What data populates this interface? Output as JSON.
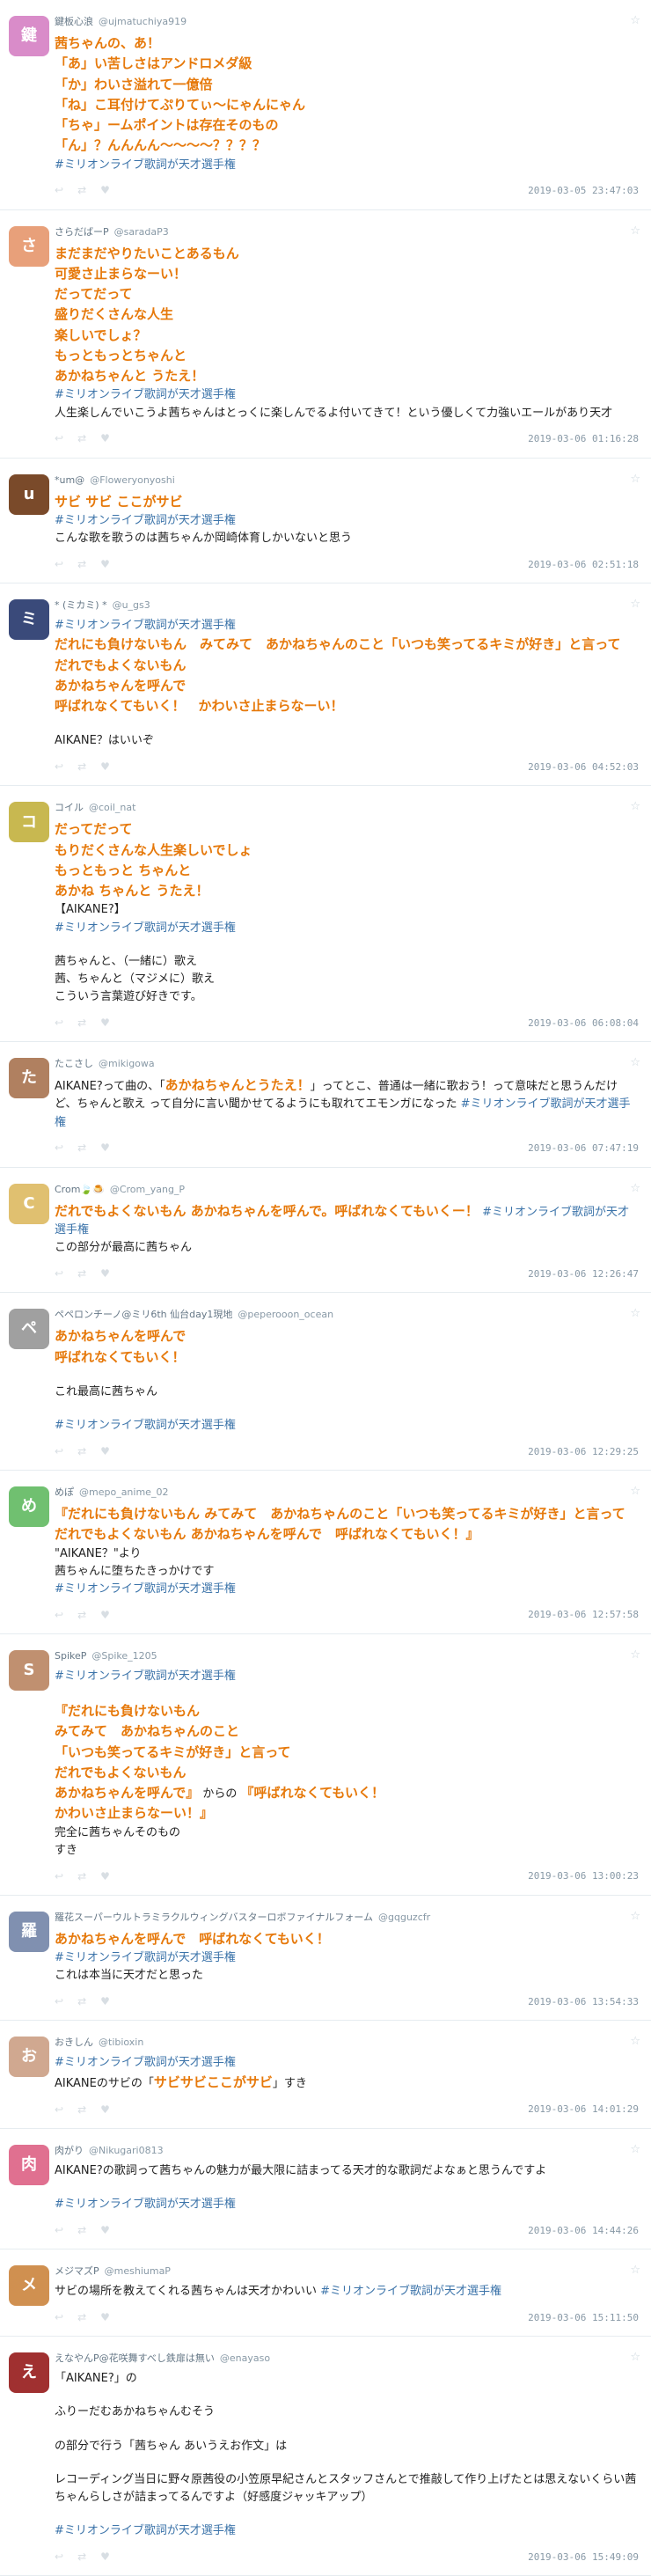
{
  "hashtag": "#ミリオンライブ歌詞が天才選手権",
  "tweets": [
    {
      "name": "鍵板心浪",
      "handle": "@ujmatuchiya919",
      "date": "2019-03-05 23:47:03",
      "avatar_color": "#d98cc9",
      "avatar_glyph": "鍵",
      "lines": [
        {
          "t": "em",
          "text": "茜ちゃんの、あ！"
        },
        {
          "t": "em",
          "text": "「あ」い苦しさはアンドロメダ級"
        },
        {
          "t": "em",
          "text": "「か」わいさ溢れて一億倍"
        },
        {
          "t": "em",
          "text": "「ね」こ耳付けてぷりてぃ〜にゃんにゃん"
        },
        {
          "t": "em",
          "text": "「ちゃ」ームポイントは存在そのもの"
        },
        {
          "t": "em",
          "text": "「ん」？んんんん〜〜〜〜？？？？"
        },
        {
          "t": "tag",
          "text": "#ミリオンライブ歌詞が天才選手権"
        }
      ]
    },
    {
      "name": "さらだばーP",
      "handle": "@saradaP3",
      "date": "2019-03-06 01:16:28",
      "avatar_color": "#e8a07a",
      "avatar_glyph": "さ",
      "lines": [
        {
          "t": "em",
          "text": "まだまだやりたいことあるもん"
        },
        {
          "t": "em",
          "text": "可愛さ止まらなーい！"
        },
        {
          "t": "em",
          "text": "だってだって"
        },
        {
          "t": "em",
          "text": "盛りだくさんな人生"
        },
        {
          "t": "em",
          "text": "楽しいでしょ？"
        },
        {
          "t": "em",
          "text": "もっともっとちゃんと"
        },
        {
          "t": "em",
          "text": "あかねちゃんと うたえ！"
        },
        {
          "t": "tag",
          "text": "#ミリオンライブ歌詞が天才選手権"
        },
        {
          "t": "plain",
          "text": "人生楽しんでいこうよ茜ちゃんはとっくに楽しんでるよ付いてきて！という優しくて力強いエールがあり天才"
        }
      ]
    },
    {
      "name": "*um@",
      "handle": "@Floweryonyoshi",
      "date": "2019-03-06 02:51:18",
      "avatar_color": "#7a4a2a",
      "avatar_glyph": "u",
      "lines": [
        {
          "t": "em",
          "text": "サビ サビ ここがサビ"
        },
        {
          "t": "tag",
          "text": "#ミリオンライブ歌詞が天才選手権"
        },
        {
          "t": "plain",
          "text": "こんな歌を歌うのは茜ちゃんか岡崎体育しかいないと思う"
        }
      ]
    },
    {
      "name": "* (ミカミ) *",
      "handle": "@u_gs3",
      "date": "2019-03-06 04:52:03",
      "avatar_color": "#3a4a7a",
      "avatar_glyph": "ミ",
      "lines": [
        {
          "t": "tag",
          "text": "#ミリオンライブ歌詞が天才選手権"
        },
        {
          "t": "em",
          "text": "だれにも負けないもん　みてみて　あかねちゃんのこと「いつも笑ってるキミが好き」と言って"
        },
        {
          "t": "em",
          "text": "だれでもよくないもん"
        },
        {
          "t": "em",
          "text": "あかねちゃんを呼んで"
        },
        {
          "t": "em",
          "text": "呼ばれなくてもいく！　かわいさ止まらなーい！"
        },
        {
          "t": "blank",
          "text": ""
        },
        {
          "t": "plain",
          "text": "AIKANE？はいいぞ"
        }
      ]
    },
    {
      "name": "コイル",
      "handle": "@coil_nat",
      "date": "2019-03-06 06:08:04",
      "avatar_color": "#c8b850",
      "avatar_glyph": "コ",
      "lines": [
        {
          "t": "em",
          "text": "だってだって"
        },
        {
          "t": "em",
          "text": "もりだくさんな人生楽しいでしょ"
        },
        {
          "t": "em",
          "text": "もっともっと ちゃんと"
        },
        {
          "t": "em",
          "text": "あかね ちゃんと うたえ！"
        },
        {
          "t": "plain",
          "text": "【AIKANE?】"
        },
        {
          "t": "tag",
          "text": "#ミリオンライブ歌詞が天才選手権"
        },
        {
          "t": "blank",
          "text": ""
        },
        {
          "t": "plain",
          "text": "茜ちゃんと、（一緒に）歌え"
        },
        {
          "t": "plain",
          "text": "茜、ちゃんと（マジメに）歌え"
        },
        {
          "t": "plain",
          "text": "こういう言葉遊び好きです。"
        }
      ]
    },
    {
      "name": "たこさし",
      "handle": "@mikigowa",
      "date": "2019-03-06 07:47:19",
      "avatar_color": "#b08060",
      "avatar_glyph": "た",
      "lines": [
        {
          "t": "mixed",
          "parts": [
            {
              "k": "plain",
              "text": "AIKANE?って曲の、「"
            },
            {
              "k": "em",
              "text": "あかねちゃんとうたえ！"
            },
            {
              "k": "plain",
              "text": "」ってとこ、普通は一緒に歌おう！って意味だと思うんだけど、ちゃんと歌え って自分に言い聞かせてるようにも取れてエモンガになった "
            },
            {
              "k": "tag",
              "text": "#ミリオンライブ歌詞が天才選手権"
            }
          ]
        }
      ]
    },
    {
      "name": "Crom🍃🍮",
      "handle": "@Crom_yang_P",
      "date": "2019-03-06 12:26:47",
      "avatar_color": "#e0c070",
      "avatar_glyph": "C",
      "lines": [
        {
          "t": "mixed",
          "parts": [
            {
              "k": "em",
              "text": "だれでもよくないもん あかねちゃんを呼んで。呼ばれなくてもいくー！"
            },
            {
              "k": "plain",
              "text": " "
            },
            {
              "k": "tag",
              "text": "#ミリオンライブ歌詞が天才選手権"
            }
          ]
        },
        {
          "t": "plain",
          "text": "この部分が最高に茜ちゃん"
        }
      ]
    },
    {
      "name": "ペペロンチーノ@ミリ6th 仙台day1現地",
      "handle": "@peperooon_ocean",
      "date": "2019-03-06 12:29:25",
      "avatar_color": "#a0a0a0",
      "avatar_glyph": "ペ",
      "lines": [
        {
          "t": "em",
          "text": "あかねちゃんを呼んで"
        },
        {
          "t": "em",
          "text": "呼ばれなくてもいく！"
        },
        {
          "t": "blank",
          "text": ""
        },
        {
          "t": "plain",
          "text": "これ最高に茜ちゃん"
        },
        {
          "t": "blank",
          "text": ""
        },
        {
          "t": "tag",
          "text": "#ミリオンライブ歌詞が天才選手権"
        }
      ]
    },
    {
      "name": "めぽ",
      "handle": "@mepo_anime_02",
      "date": "2019-03-06 12:57:58",
      "avatar_color": "#70c070",
      "avatar_glyph": "め",
      "lines": [
        {
          "t": "em",
          "text": "『だれにも負けないもん みてみて　あかねちゃんのこと「いつも笑ってるキミが好き」と言って だれでもよくないもん あかねちゃんを呼んで　呼ばれなくてもいく！』"
        },
        {
          "t": "plain",
          "text": "\"AIKANE？\"より"
        },
        {
          "t": "plain",
          "text": "茜ちゃんに堕ちたきっかけです"
        },
        {
          "t": "tag",
          "text": "#ミリオンライブ歌詞が天才選手権"
        }
      ]
    },
    {
      "name": "SpikeP",
      "handle": "@Spike_1205",
      "date": "2019-03-06 13:00:23",
      "avatar_color": "#c09070",
      "avatar_glyph": "S",
      "lines": [
        {
          "t": "tag",
          "text": "#ミリオンライブ歌詞が天才選手権"
        },
        {
          "t": "blank",
          "text": ""
        },
        {
          "t": "em",
          "text": "『だれにも負けないもん"
        },
        {
          "t": "em",
          "text": "みてみて　あかねちゃんのこと"
        },
        {
          "t": "em",
          "text": "「いつも笑ってるキミが好き」と言って"
        },
        {
          "t": "em",
          "text": "だれでもよくないもん"
        },
        {
          "t": "mixed",
          "parts": [
            {
              "k": "em",
              "text": "あかねちゃんを呼んで』"
            },
            {
              "k": "plain",
              "text": " からの "
            },
            {
              "k": "em",
              "text": "『呼ばれなくてもいく！"
            }
          ]
        },
        {
          "t": "em",
          "text": "かわいさ止まらなーい！』"
        },
        {
          "t": "plain",
          "text": "完全に茜ちゃんそのもの"
        },
        {
          "t": "plain",
          "text": "すき"
        }
      ]
    },
    {
      "name": "羅花スーパーウルトラミラクルウィングバスターロボファイナルフォーム",
      "handle": "@gqguzcfr",
      "date": "2019-03-06 13:54:33",
      "avatar_color": "#8090b0",
      "avatar_glyph": "羅",
      "lines": [
        {
          "t": "em",
          "text": "あかねちゃんを呼んで　呼ばれなくてもいく！"
        },
        {
          "t": "tag",
          "text": "#ミリオンライブ歌詞が天才選手権"
        },
        {
          "t": "plain",
          "text": "これは本当に天才だと思った"
        }
      ]
    },
    {
      "name": "おきしん",
      "handle": "@tibioxin",
      "date": "2019-03-06 14:01:29",
      "avatar_color": "#d0a890",
      "avatar_glyph": "お",
      "lines": [
        {
          "t": "tag",
          "text": "#ミリオンライブ歌詞が天才選手権"
        },
        {
          "t": "mixed",
          "parts": [
            {
              "k": "plain",
              "text": "AIKANEのサビの「"
            },
            {
              "k": "em",
              "text": "サビサビここがサビ"
            },
            {
              "k": "plain",
              "text": "」すき"
            }
          ]
        }
      ]
    },
    {
      "name": "肉がり",
      "handle": "@Nikugari0813",
      "date": "2019-03-06 14:44:26",
      "avatar_color": "#e07090",
      "avatar_glyph": "肉",
      "lines": [
        {
          "t": "plain",
          "text": "AIKANE?の歌詞って茜ちゃんの魅力が最大限に詰まってる天才的な歌詞だよなぁと思うんですよ"
        },
        {
          "t": "blank",
          "text": ""
        },
        {
          "t": "tag",
          "text": "#ミリオンライブ歌詞が天才選手権"
        }
      ]
    },
    {
      "name": "メジマズP",
      "handle": "@meshiumaP",
      "date": "2019-03-06 15:11:50",
      "avatar_color": "#d09050",
      "avatar_glyph": "メ",
      "lines": [
        {
          "t": "mixed",
          "parts": [
            {
              "k": "plain",
              "text": "サビの場所を教えてくれる茜ちゃんは天才かわいい "
            },
            {
              "k": "tag",
              "text": "#ミリオンライブ歌詞が天才選手権"
            }
          ]
        }
      ]
    },
    {
      "name": "えなやんP@花咲舞すべし鉄扉は無い",
      "handle": "@enayaso",
      "date": "2019-03-06 15:49:09",
      "avatar_color": "#a03030",
      "avatar_glyph": "え",
      "lines": [
        {
          "t": "plain",
          "text": "「AIKANE?」の"
        },
        {
          "t": "blank",
          "text": ""
        },
        {
          "t": "plain",
          "text": "ふりーだむあかねちゃんむそう"
        },
        {
          "t": "blank",
          "text": ""
        },
        {
          "t": "plain",
          "text": "の部分で行う「茜ちゃん あいうえお作文」は"
        },
        {
          "t": "blank",
          "text": ""
        },
        {
          "t": "plain",
          "text": "レコーディング当日に野々原茜役の小笠原早紀さんとスタッフさんとで推敲して作り上げたとは思えないくらい茜ちゃんらしさが詰まってるんですよ（好感度ジャッキアップ）"
        },
        {
          "t": "blank",
          "text": ""
        },
        {
          "t": "tag",
          "text": "#ミリオンライブ歌詞が天才選手権"
        }
      ]
    }
  ]
}
